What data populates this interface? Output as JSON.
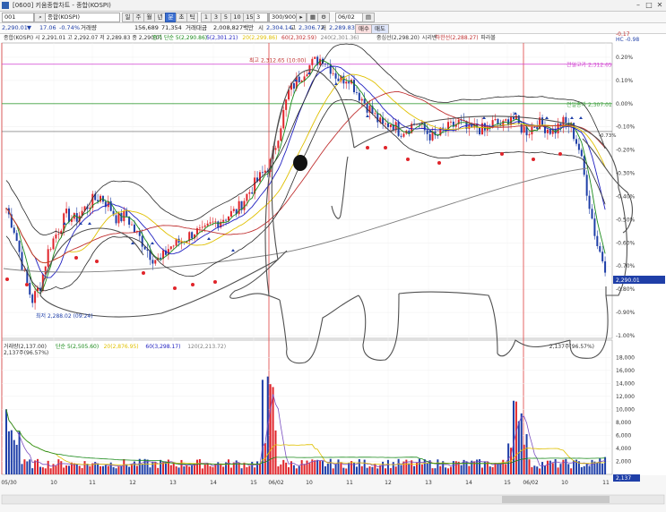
{
  "window": {
    "title": "[0600] 키움종합차트 - 종합(KOSPI)"
  },
  "toolbar": {
    "code": "001",
    "name": "종합(KOSPI)",
    "period_buttons": [
      "일",
      "주",
      "월",
      "년",
      "분",
      "초",
      "틱"
    ],
    "selected_period": "분",
    "interval_buttons": [
      "1",
      "3",
      "5",
      "10",
      "15",
      "30",
      "45",
      "60"
    ],
    "interval_value": "3",
    "count_value": "300/900",
    "date_value": "06/02"
  },
  "quote_bar": {
    "price": "2,290.01",
    "change": "17.06",
    "change_pct": "-0.74%",
    "volume_label": "거래량",
    "volume": "156,689",
    "volume2": "71,354",
    "amount_label": "거래대금",
    "amount": "2,008,827백만",
    "open_label": "시",
    "open": "2,304.14",
    "high_label": "고",
    "high": "2,306.72",
    "low_label": "저",
    "low": "2,289.83",
    "buy_label": "매수",
    "sell_label": "매도"
  },
  "legend": {
    "main": "종합(KOSPI) 시 2,291.01 고 2,292.07 저 2,289.83 종 2,290.01",
    "ma": [
      "종가 단순 5(2,290.86)",
      "5(2,301.21)",
      "20(2,299.86)",
      "60(2,302.59)",
      "240(2,301.36)"
    ],
    "bands": [
      "중심선(2,298.20)",
      "시리밴",
      "하한선(2,288.27)",
      "파라볼"
    ]
  },
  "annotations": {
    "high_label": "최고 2,312.65 (10:00)",
    "low_label": "최저 2,288.02 (09:24)",
    "prev_high": "전일고가 2,312.65",
    "prev_close": "전일종가 2,307.01",
    "current_pct": "-0.73%",
    "price_tag": "2,290.01",
    "volume_tag": "2,137"
  },
  "volume_legend": {
    "main": "거래량(2,137.00)",
    "ma": [
      "단순 5(2,505.60)",
      "20(2,876.95)",
      "60(3,298.17)",
      "120(2,213.72)"
    ],
    "sub": "2,137주(96.57%)",
    "right": "2,137주(96.57%)"
  },
  "colors": {
    "up": "#e0242a",
    "down": "#1f3fa8",
    "ma5": "#1a8a1a",
    "ma20": "#2020c0",
    "ma60": "#e0c000",
    "ma120": "#c03030",
    "ma240": "#808080",
    "band": "#2a2a2a",
    "prev_high_line": "#d040d0",
    "prev_close_line": "#40a040"
  },
  "chart_data": [
    {
      "type": "candlestick",
      "title": "",
      "y_right_ticks": [
        "0.20%",
        "0.10%",
        "0.00%",
        "-0.10%",
        "-0.20%",
        "-0.30%",
        "-0.40%",
        "-0.50%",
        "-0.60%",
        "-0.70%",
        "-0.80%",
        "-0.90%",
        "-1.00%"
      ],
      "y_right_top": [
        "-0.17",
        "HC -0.98"
      ],
      "x_ticks": [
        "05/30",
        "10",
        "11",
        "12",
        "13",
        "14",
        "15",
        "06/02",
        "10",
        "11",
        "12",
        "13",
        "14",
        "15",
        "06/02",
        "10",
        "11"
      ],
      "ylim": [
        -1.0,
        0.25
      ],
      "percent_series": [
        -0.45,
        -0.55,
        -0.72,
        -0.85,
        -0.78,
        -0.62,
        -0.55,
        -0.48,
        -0.5,
        -0.46,
        -0.42,
        -0.4,
        -0.44,
        -0.5,
        -0.48,
        -0.55,
        -0.6,
        -0.66,
        -0.68,
        -0.62,
        -0.6,
        -0.58,
        -0.55,
        -0.56,
        -0.52,
        -0.5,
        -0.48,
        -0.46,
        -0.4,
        -0.35,
        -0.3,
        -0.25,
        -0.1,
        0.05,
        0.1,
        0.15,
        0.18,
        0.2,
        0.15,
        0.1,
        0.12,
        0.05,
        0.0,
        -0.05,
        -0.1,
        -0.08,
        -0.12,
        -0.1,
        -0.08,
        -0.12,
        -0.15,
        -0.12,
        -0.1,
        -0.08,
        -0.12,
        -0.1,
        -0.12,
        -0.08,
        -0.1,
        -0.05,
        -0.1,
        -0.12,
        -0.08,
        -0.1,
        -0.12,
        -0.08,
        -0.1,
        -0.2,
        -0.4,
        -0.6,
        -0.7
      ]
    },
    {
      "type": "bar",
      "title": "",
      "y_right_ticks": [
        "18,000",
        "16,000",
        "14,000",
        "12,000",
        "10,000",
        "8,000",
        "6,000",
        "4,000",
        "2,000"
      ],
      "ylim": [
        0,
        19000
      ],
      "x_ticks": [
        "05/30",
        "10",
        "11",
        "12",
        "13",
        "14",
        "15",
        "06/02",
        "10",
        "11",
        "12",
        "13",
        "14",
        "15",
        "06/02",
        "10",
        "11"
      ]
    }
  ]
}
